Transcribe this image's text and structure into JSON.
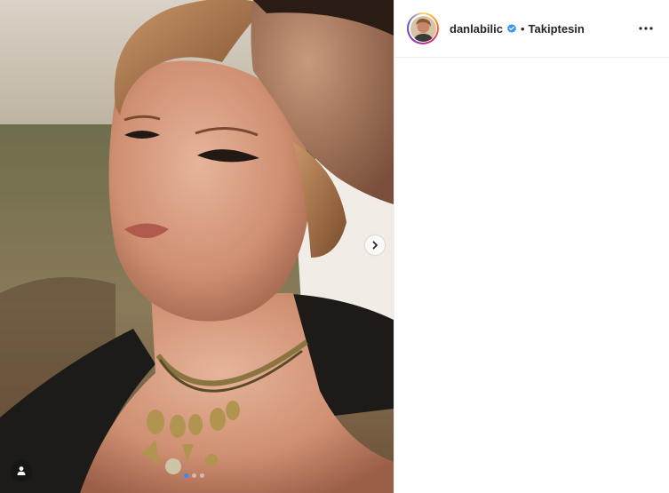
{
  "post": {
    "author": {
      "username": "danlabilic",
      "verified": true,
      "follow_status": "Takiptesin",
      "separator": "•"
    },
    "carousel": {
      "total_slides": 3,
      "active_slide": 1
    },
    "icons": {
      "verified": "verified-badge-icon",
      "more": "more-options-icon",
      "next": "chevron-right-icon",
      "tag": "user-tag-icon"
    },
    "colors": {
      "verified": "#3897f0",
      "active_dot": "#2f8cff",
      "text": "#262626"
    }
  }
}
